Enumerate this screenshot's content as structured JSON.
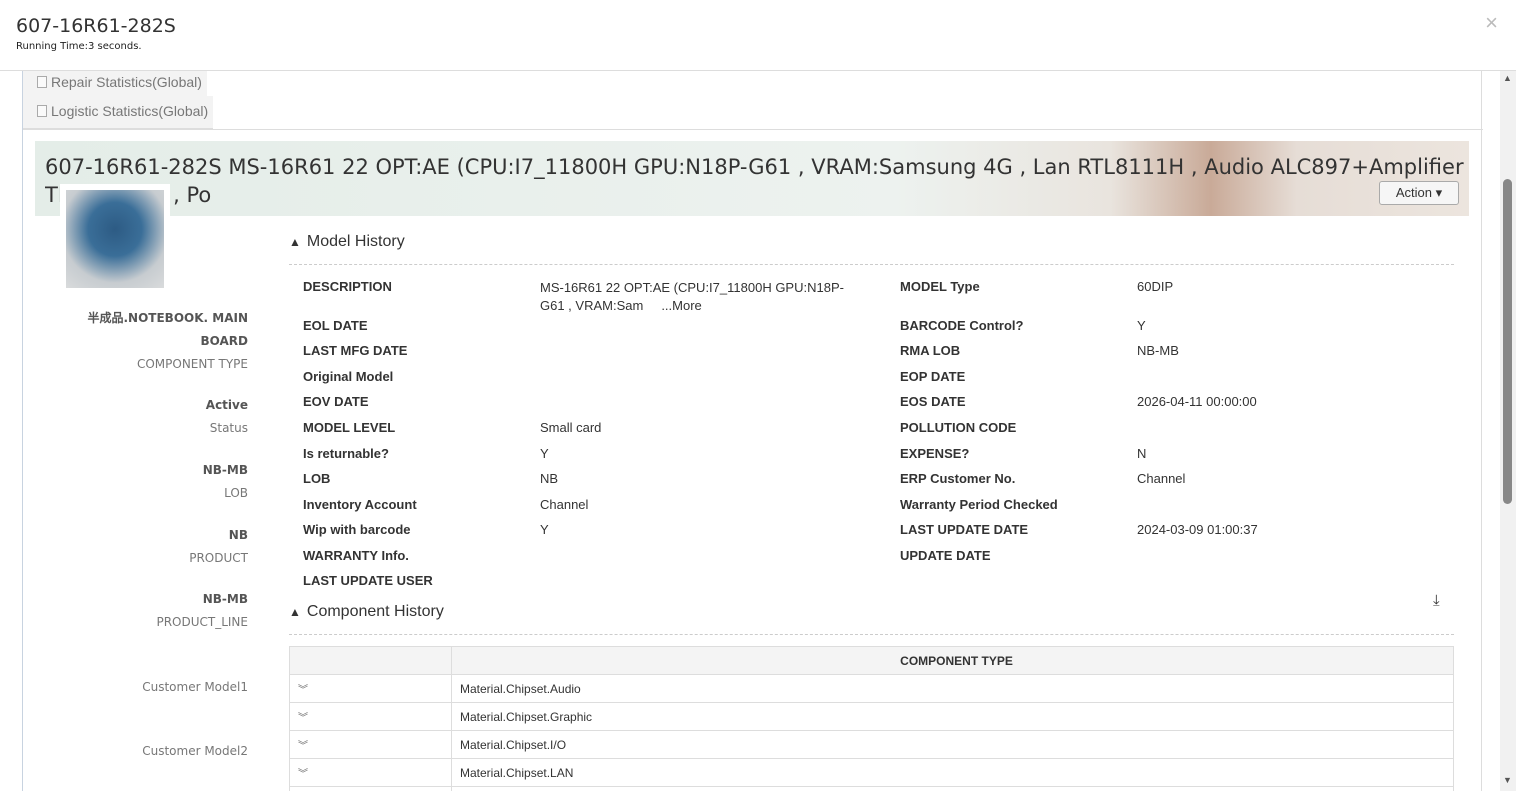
{
  "header": {
    "title": "607-16R61-282S",
    "subtitle": "Running Time:3 seconds.",
    "close": "×"
  },
  "tabs": [
    {
      "label": "Repair Statistics(Global)"
    },
    {
      "label": "Logistic Statistics(Global)"
    }
  ],
  "banner": {
    "title": "607-16R61-282S MS-16R61 22 OPT:AE (CPU:I7_11800H GPU:N18P-G61 , VRAM:Samsung 4G , Lan RTL8111H , Audio ALC897+Amplifier TPA2010D1 , Po",
    "action": "Action ▾"
  },
  "left": [
    {
      "v": "半成品.NOTEBOOK. MAIN BOARD",
      "k": "COMPONENT TYPE"
    },
    {
      "v": "Active",
      "k": "Status"
    },
    {
      "v": "NB-MB",
      "k": "LOB"
    },
    {
      "v": "NB",
      "k": "PRODUCT"
    },
    {
      "v": "NB-MB",
      "k": "PRODUCT_LINE"
    },
    {
      "v": "",
      "k": "Customer Model1"
    },
    {
      "v": "",
      "k": "Customer Model2"
    }
  ],
  "model_history": {
    "title": "Model History",
    "more": "...More",
    "left": [
      [
        "DESCRIPTION",
        "MS-16R61 22 OPT:AE (CPU:I7_11800H GPU:N18P-G61 , VRAM:Sam"
      ],
      [
        "EOL DATE",
        ""
      ],
      [
        "LAST MFG DATE",
        ""
      ],
      [
        "Original Model",
        ""
      ],
      [
        "EOV DATE",
        ""
      ],
      [
        "MODEL LEVEL",
        "Small card"
      ],
      [
        "Is returnable?",
        "Y"
      ],
      [
        "LOB",
        "NB"
      ],
      [
        "Inventory Account",
        "Channel"
      ],
      [
        "Wip with barcode",
        "Y"
      ],
      [
        "WARRANTY Info.",
        ""
      ],
      [
        "LAST UPDATE USER",
        ""
      ]
    ],
    "right": [
      [
        "MODEL Type",
        "60DIP"
      ],
      [
        "BARCODE Control?",
        "Y"
      ],
      [
        "RMA LOB",
        "NB-MB"
      ],
      [
        "EOP DATE",
        ""
      ],
      [
        "EOS DATE",
        "2026-04-11 00:00:00"
      ],
      [
        "POLLUTION CODE",
        ""
      ],
      [
        "EXPENSE?",
        "N"
      ],
      [
        "ERP Customer No.",
        "Channel"
      ],
      [
        "Warranty Period Checked",
        ""
      ],
      [
        "LAST UPDATE DATE",
        "2024-03-09 01:00:37"
      ],
      [
        "UPDATE DATE",
        ""
      ]
    ]
  },
  "component_history": {
    "title": "Component History",
    "column": "COMPONENT TYPE",
    "rows": [
      "Material.Chipset.Audio",
      "Material.Chipset.Graphic",
      "Material.Chipset.I/O",
      "Material.Chipset.LAN"
    ]
  }
}
